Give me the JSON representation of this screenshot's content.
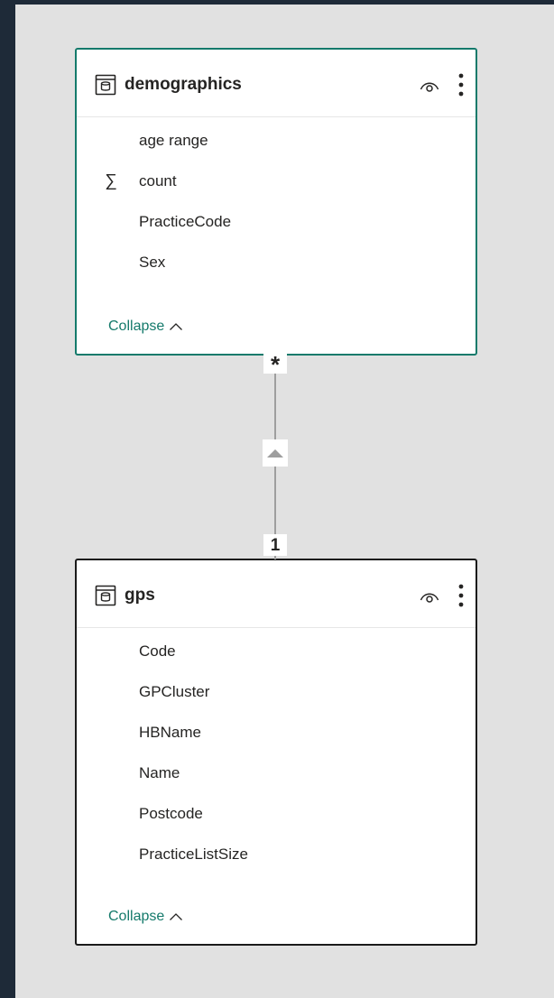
{
  "tables": [
    {
      "name": "demographics",
      "fields": [
        {
          "label": "age range",
          "icon": ""
        },
        {
          "label": "count",
          "icon": "sigma-icon"
        },
        {
          "label": "PracticeCode",
          "icon": ""
        },
        {
          "label": "Sex",
          "icon": ""
        }
      ],
      "collapse_label": "Collapse",
      "selected": true
    },
    {
      "name": "gps",
      "fields": [
        {
          "label": "Code",
          "icon": ""
        },
        {
          "label": "GPCluster",
          "icon": ""
        },
        {
          "label": "HBName",
          "icon": ""
        },
        {
          "label": "Name",
          "icon": ""
        },
        {
          "label": "Postcode",
          "icon": ""
        },
        {
          "label": "PracticeListSize",
          "icon": ""
        }
      ],
      "collapse_label": "Collapse",
      "selected": false
    }
  ],
  "relationship": {
    "from_cardinality": "*",
    "to_cardinality": "1",
    "cross_filter_icon": "triangle-up-icon"
  },
  "colors": {
    "accent": "#147a6b",
    "canvas": "#e1e1e1",
    "frame": "#1e2a38"
  }
}
